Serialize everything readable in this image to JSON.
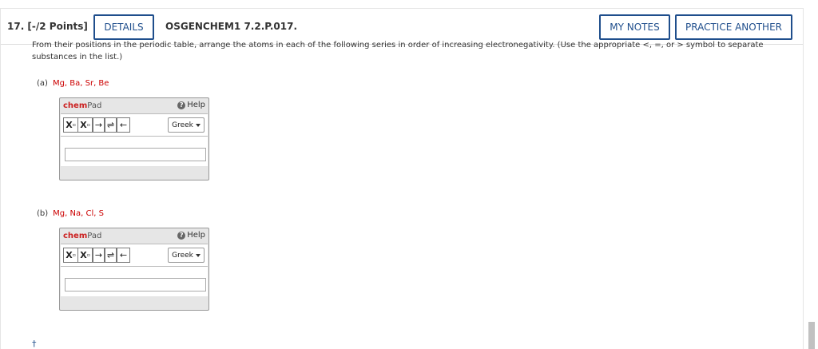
{
  "header": {
    "question_number": "17. [-/2 Points]",
    "details_label": "DETAILS",
    "question_code": "OSGENCHEM1 7.2.P.017.",
    "my_notes_label": "MY NOTES",
    "practice_label": "PRACTICE ANOTHER"
  },
  "prompt": "From their positions in the periodic table, arrange the atoms in each of the following series in order of increasing electronegativity. (Use the appropriate <, =, or > symbol to separate substances in the list.)",
  "parts": [
    {
      "label": "(a)",
      "elements": "Mg, Ba, Sr, Be"
    },
    {
      "label": "(b)",
      "elements": "Mg, Na, Cl, S"
    }
  ],
  "chempad": {
    "title_prefix": "chem",
    "title_suffix": "Pad",
    "help_label": "Help",
    "help_icon": "question-circle-icon",
    "subscript_label": "X",
    "superscript_label": "X",
    "right_arrow": "→",
    "equilibrium_arrow": "⇌",
    "left_arrow": "←",
    "greek_label": "Greek",
    "answer_a": "",
    "answer_b": ""
  },
  "footer": {
    "dagger": "†"
  },
  "colors": {
    "accent": "#1f4e8c",
    "element_red": "#cc0000",
    "chem_red": "#cc2222"
  }
}
